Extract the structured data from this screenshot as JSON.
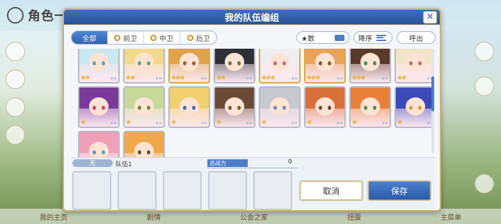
{
  "background": {
    "screen_title": "角色一览",
    "bottom_nav": [
      "我的主页",
      "剧情",
      "公会之家",
      "扭蛋",
      "主菜单"
    ]
  },
  "dialog": {
    "title": "我的队伍编组",
    "close_symbol": "✕"
  },
  "filters": {
    "tabs": [
      {
        "label": "全部",
        "active": true
      },
      {
        "label": "前卫",
        "active": false
      },
      {
        "label": "中卫",
        "active": false
      },
      {
        "label": "后卫",
        "active": false
      }
    ],
    "sort_key_label": "★数",
    "order_label": "降序",
    "call_label": "呼出"
  },
  "characters": [
    {
      "hair": "#c9e8ef",
      "eye": "#5aa4c9",
      "stars": "★★",
      "frame": "silver"
    },
    {
      "hair": "#f0d98c",
      "eye": "#56a978",
      "stars": "★★",
      "frame": "silver"
    },
    {
      "hair": "#e0a24a",
      "eye": "#a05a2a",
      "stars": "★★★",
      "frame": "gold"
    },
    {
      "hair": "#2f2f38",
      "eye": "#5a7a4a",
      "stars": "★★",
      "frame": "silver"
    },
    {
      "hair": "#eeeef2",
      "eye": "#c76a8a",
      "stars": "★★★",
      "frame": "gold"
    },
    {
      "hair": "#e8a35a",
      "eye": "#8a5a2a",
      "stars": "★★★",
      "frame": "gold"
    },
    {
      "hair": "#5a3a2a",
      "eye": "#4a8a5a",
      "stars": "★★★",
      "frame": "silver"
    },
    {
      "hair": "#f2e4c8",
      "eye": "#c86a6a",
      "stars": "★★",
      "frame": "silver"
    },
    {
      "hair": "#7a3a9a",
      "eye": "#c8486a",
      "stars": "★",
      "frame": "silver"
    },
    {
      "hair": "#c8d89a",
      "eye": "#6a8a3a",
      "stars": "★",
      "frame": "silver"
    },
    {
      "hair": "#f0d070",
      "eye": "#4a6ab8",
      "stars": "★",
      "frame": "silver"
    },
    {
      "hair": "#6a4a34",
      "eye": "#7a5a34",
      "stars": "★",
      "frame": "silver"
    },
    {
      "hair": "#c8c8d0",
      "eye": "#7a8ab8",
      "stars": "★",
      "frame": "silver"
    },
    {
      "hair": "#d8703a",
      "eye": "#6a4a2a",
      "stars": "★",
      "frame": "silver"
    },
    {
      "hair": "#e8803a",
      "eye": "#5a8a4a",
      "stars": "★",
      "frame": "silver"
    },
    {
      "hair": "#3a4ab8",
      "eye": "#d8a03a",
      "stars": "★",
      "frame": "silver"
    },
    {
      "hair": "#f0a0b8",
      "eye": "#5aa0b8",
      "stars": "★",
      "frame": "silver"
    },
    {
      "hair": "#f0a84a",
      "eye": "#6a4a2a",
      "stars": "★",
      "frame": "silver"
    }
  ],
  "party": {
    "tag": "无",
    "name": "队伍1",
    "power_label": "总战力",
    "power_value": "0",
    "cancel_label": "取消",
    "save_label": "保存"
  },
  "colors": {
    "header_blue": "#2f5ca3",
    "accent_blue": "#4d7cc8",
    "frame_gold": "#c9b37a"
  }
}
